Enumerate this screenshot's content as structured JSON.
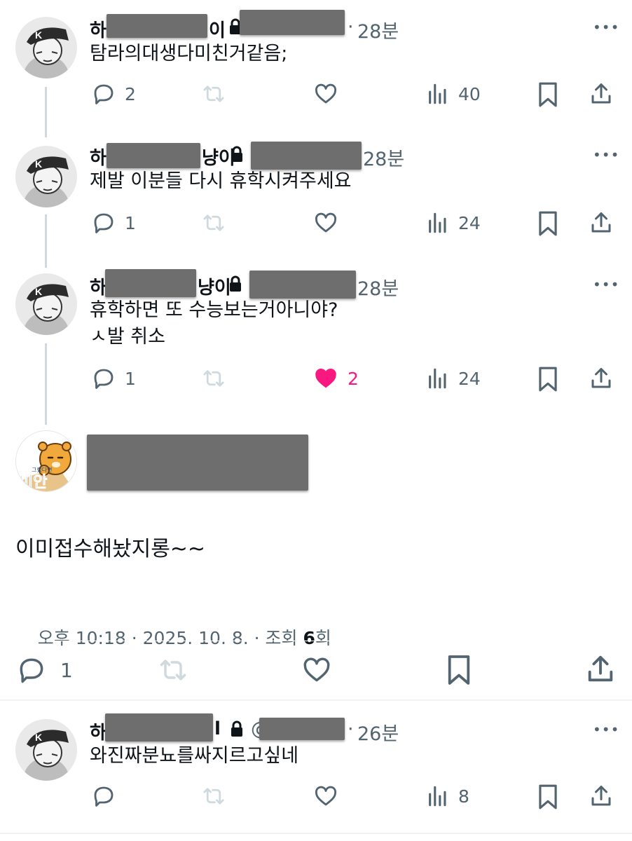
{
  "colors": {
    "text": "#0f1419",
    "muted": "#536471",
    "like": "#f91880",
    "thread_line": "#cfd9de",
    "redaction": "#6e6e6e"
  },
  "replies": [
    {
      "name_start": "하",
      "name_end": "이",
      "time": "28분",
      "text": "탐라의대생다미친거같음;",
      "replies": "2",
      "liked": false,
      "likes": "",
      "views": "40"
    },
    {
      "name_start": "하",
      "name_end": "냥이",
      "time": "28분",
      "text": "제발 이분들 다시 휴학시켜주세요",
      "replies": "1",
      "liked": false,
      "likes": "",
      "views": "24"
    },
    {
      "name_start": "하",
      "name_end": "냥이",
      "time": "28분",
      "text": "휴학하면 또 수능보는거아니야?\nㅅ발 취소",
      "replies": "1",
      "liked": true,
      "likes": "2",
      "views": "24"
    }
  ],
  "main_post": {
    "avatar_text": "미안",
    "avatar_small_text": "그랬다면",
    "text": "이미접수해놨지롱~~",
    "meta_prefix": "오후 10:18 · 2025. 10. 8. · 조회 ",
    "views": "6",
    "views_suffix": "회",
    "replies": "1"
  },
  "bottom_reply": {
    "name_start": "하",
    "name_end": "l",
    "handle_start": "@",
    "time": "26분",
    "text": "와진짜분뇨를싸지르고싶네",
    "replies": "",
    "views": "8"
  },
  "more_glyph": "•••",
  "dot": "·",
  "icons": [
    "reply-icon",
    "retweet-icon",
    "like-icon",
    "views-icon",
    "bookmark-icon",
    "share-icon",
    "lock-icon",
    "more-icon"
  ]
}
